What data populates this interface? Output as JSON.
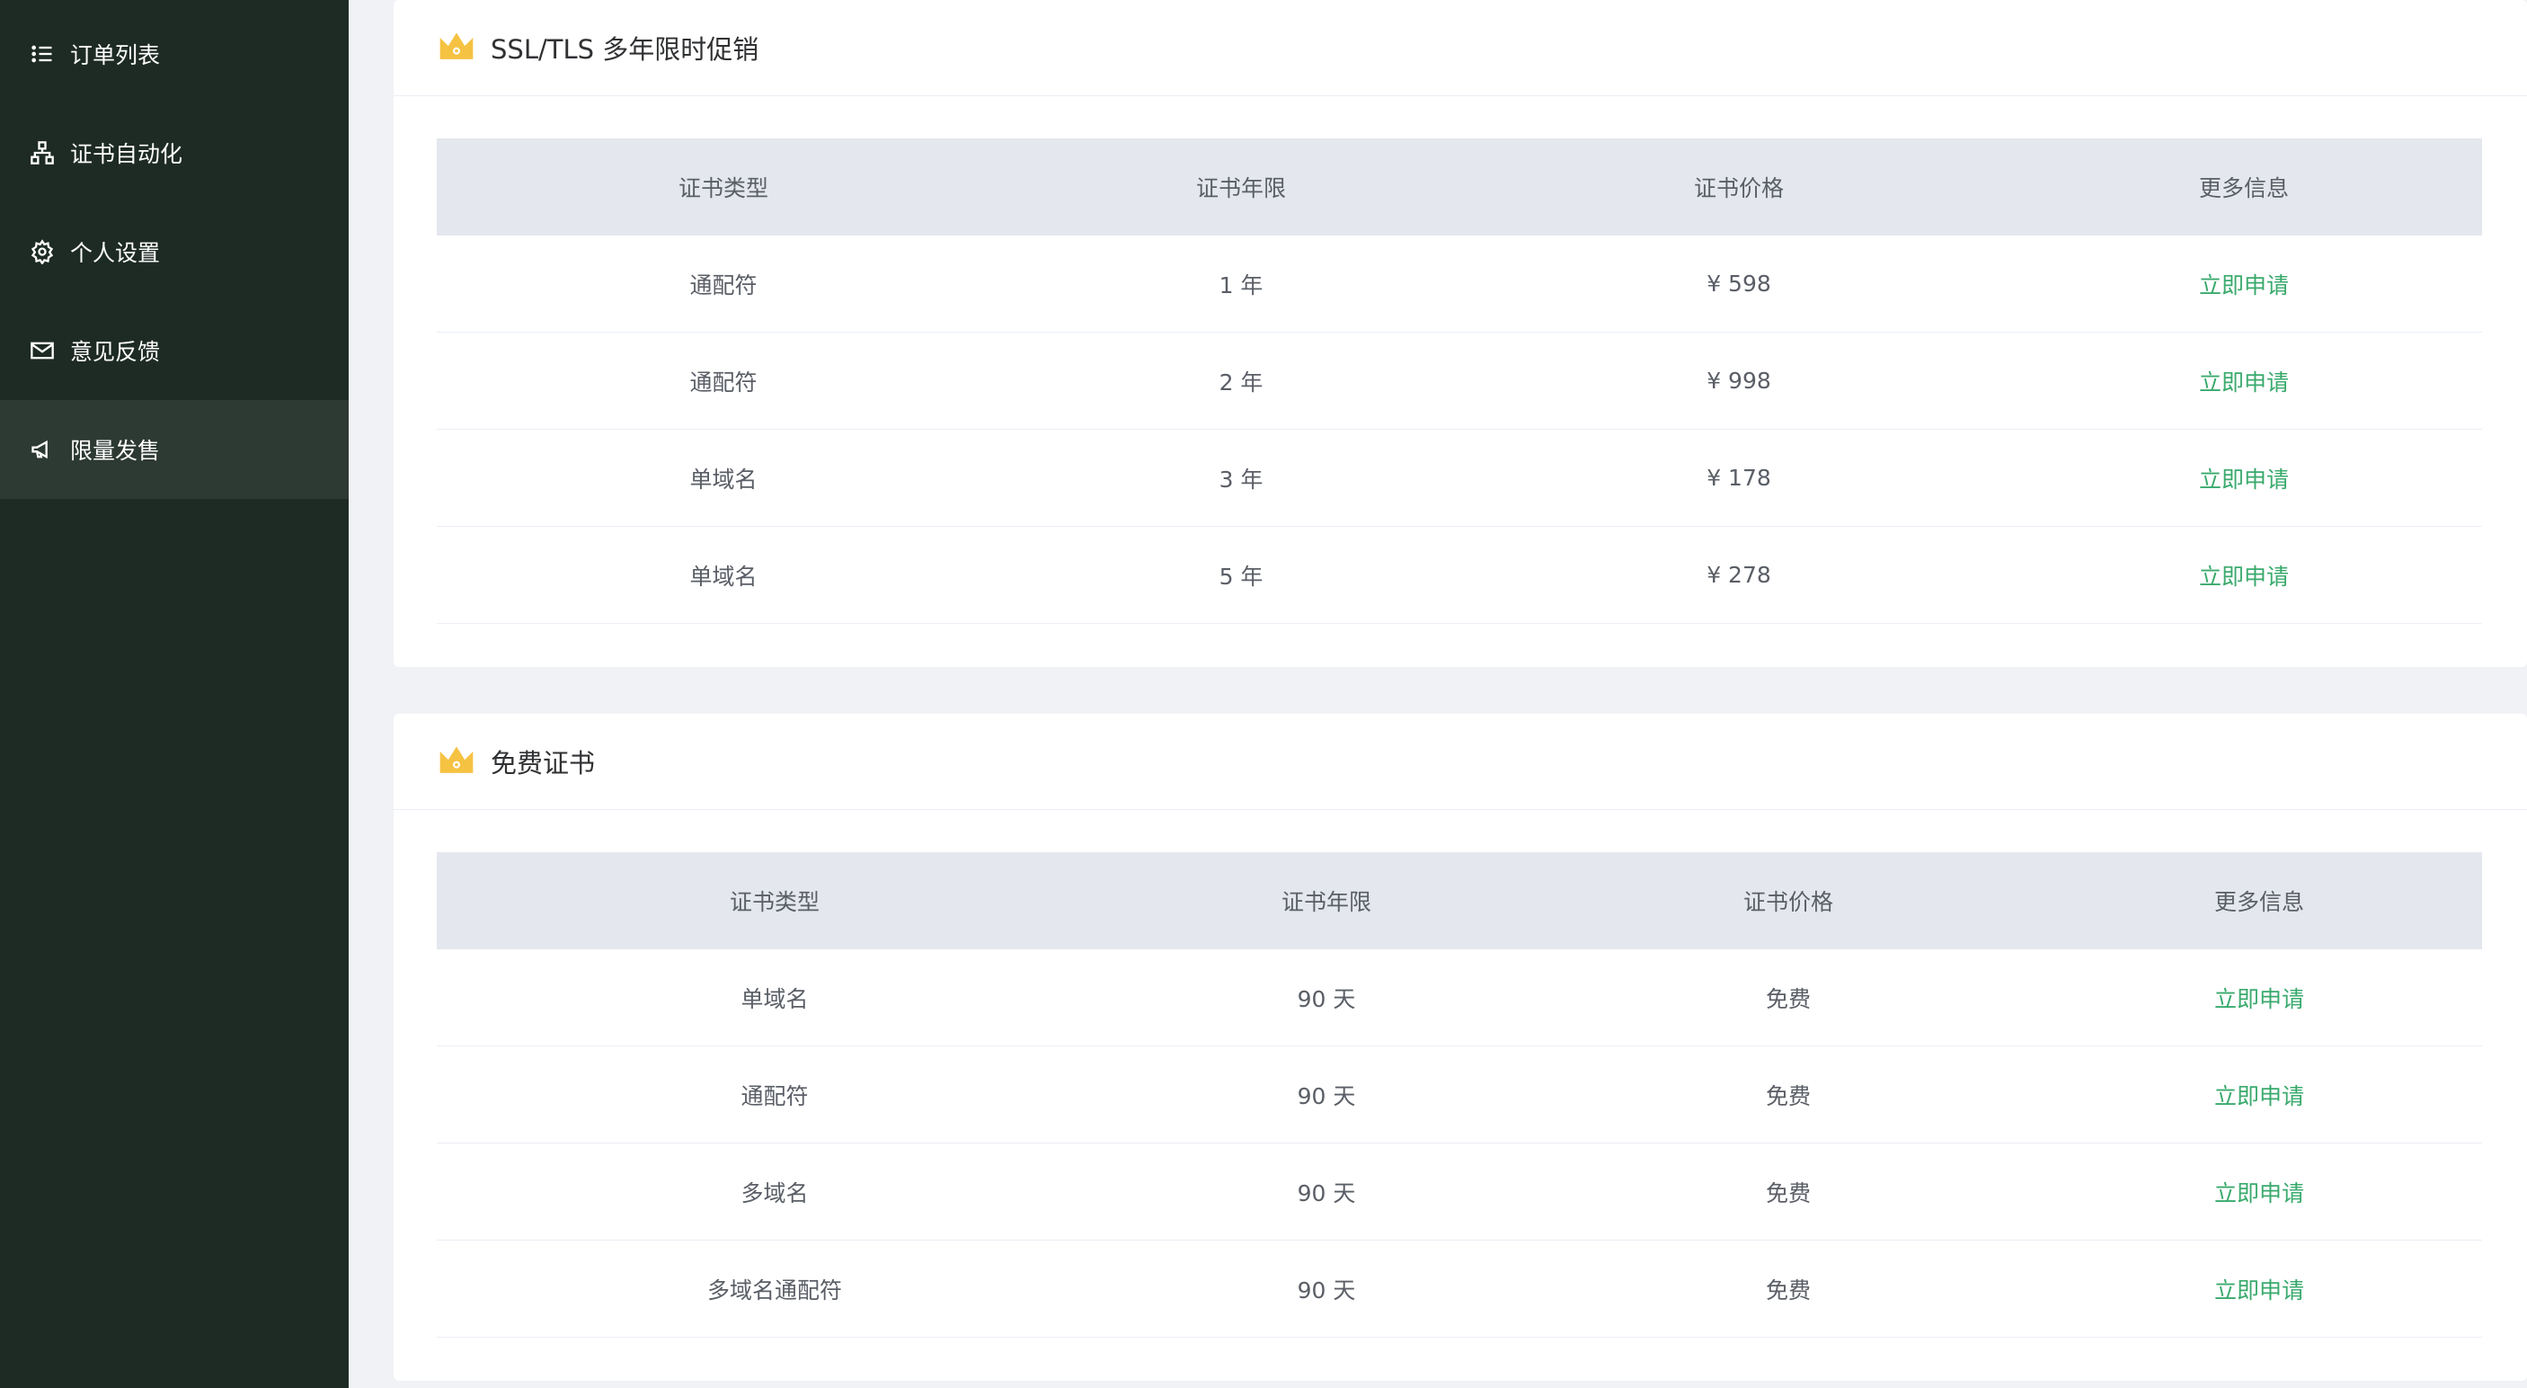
{
  "sidebar": {
    "items": [
      {
        "label": "订单列表",
        "icon": "list-icon"
      },
      {
        "label": "证书自动化",
        "icon": "sitemap-icon"
      },
      {
        "label": "个人设置",
        "icon": "gear-icon"
      },
      {
        "label": "意见反馈",
        "icon": "mail-icon"
      },
      {
        "label": "限量发售",
        "icon": "megaphone-icon"
      }
    ],
    "active_index": 4
  },
  "colors": {
    "sidebar_bg": "#1e2b25",
    "accent_link": "#3aaa6d",
    "crown": "#f5c242"
  },
  "promo": {
    "title": "SSL/TLS 多年限时促销",
    "icon": "crown-icon",
    "columns": [
      "证书类型",
      "证书年限",
      "证书价格",
      "更多信息"
    ],
    "rows": [
      [
        "通配符",
        "1 年",
        "¥ 598",
        "立即申请"
      ],
      [
        "通配符",
        "2 年",
        "¥ 998",
        "立即申请"
      ],
      [
        "单域名",
        "3 年",
        "¥ 178",
        "立即申请"
      ],
      [
        "单域名",
        "5 年",
        "¥ 278",
        "立即申请"
      ]
    ]
  },
  "free": {
    "title": "免费证书",
    "icon": "crown-icon",
    "columns": [
      "证书类型",
      "证书年限",
      "证书价格",
      "更多信息"
    ],
    "rows": [
      [
        "单域名",
        "90 天",
        "免费",
        "立即申请"
      ],
      [
        "通配符",
        "90 天",
        "免费",
        "立即申请"
      ],
      [
        "多域名",
        "90 天",
        "免费",
        "立即申请"
      ],
      [
        "多域名通配符",
        "90 天",
        "免费",
        "立即申请"
      ]
    ]
  }
}
